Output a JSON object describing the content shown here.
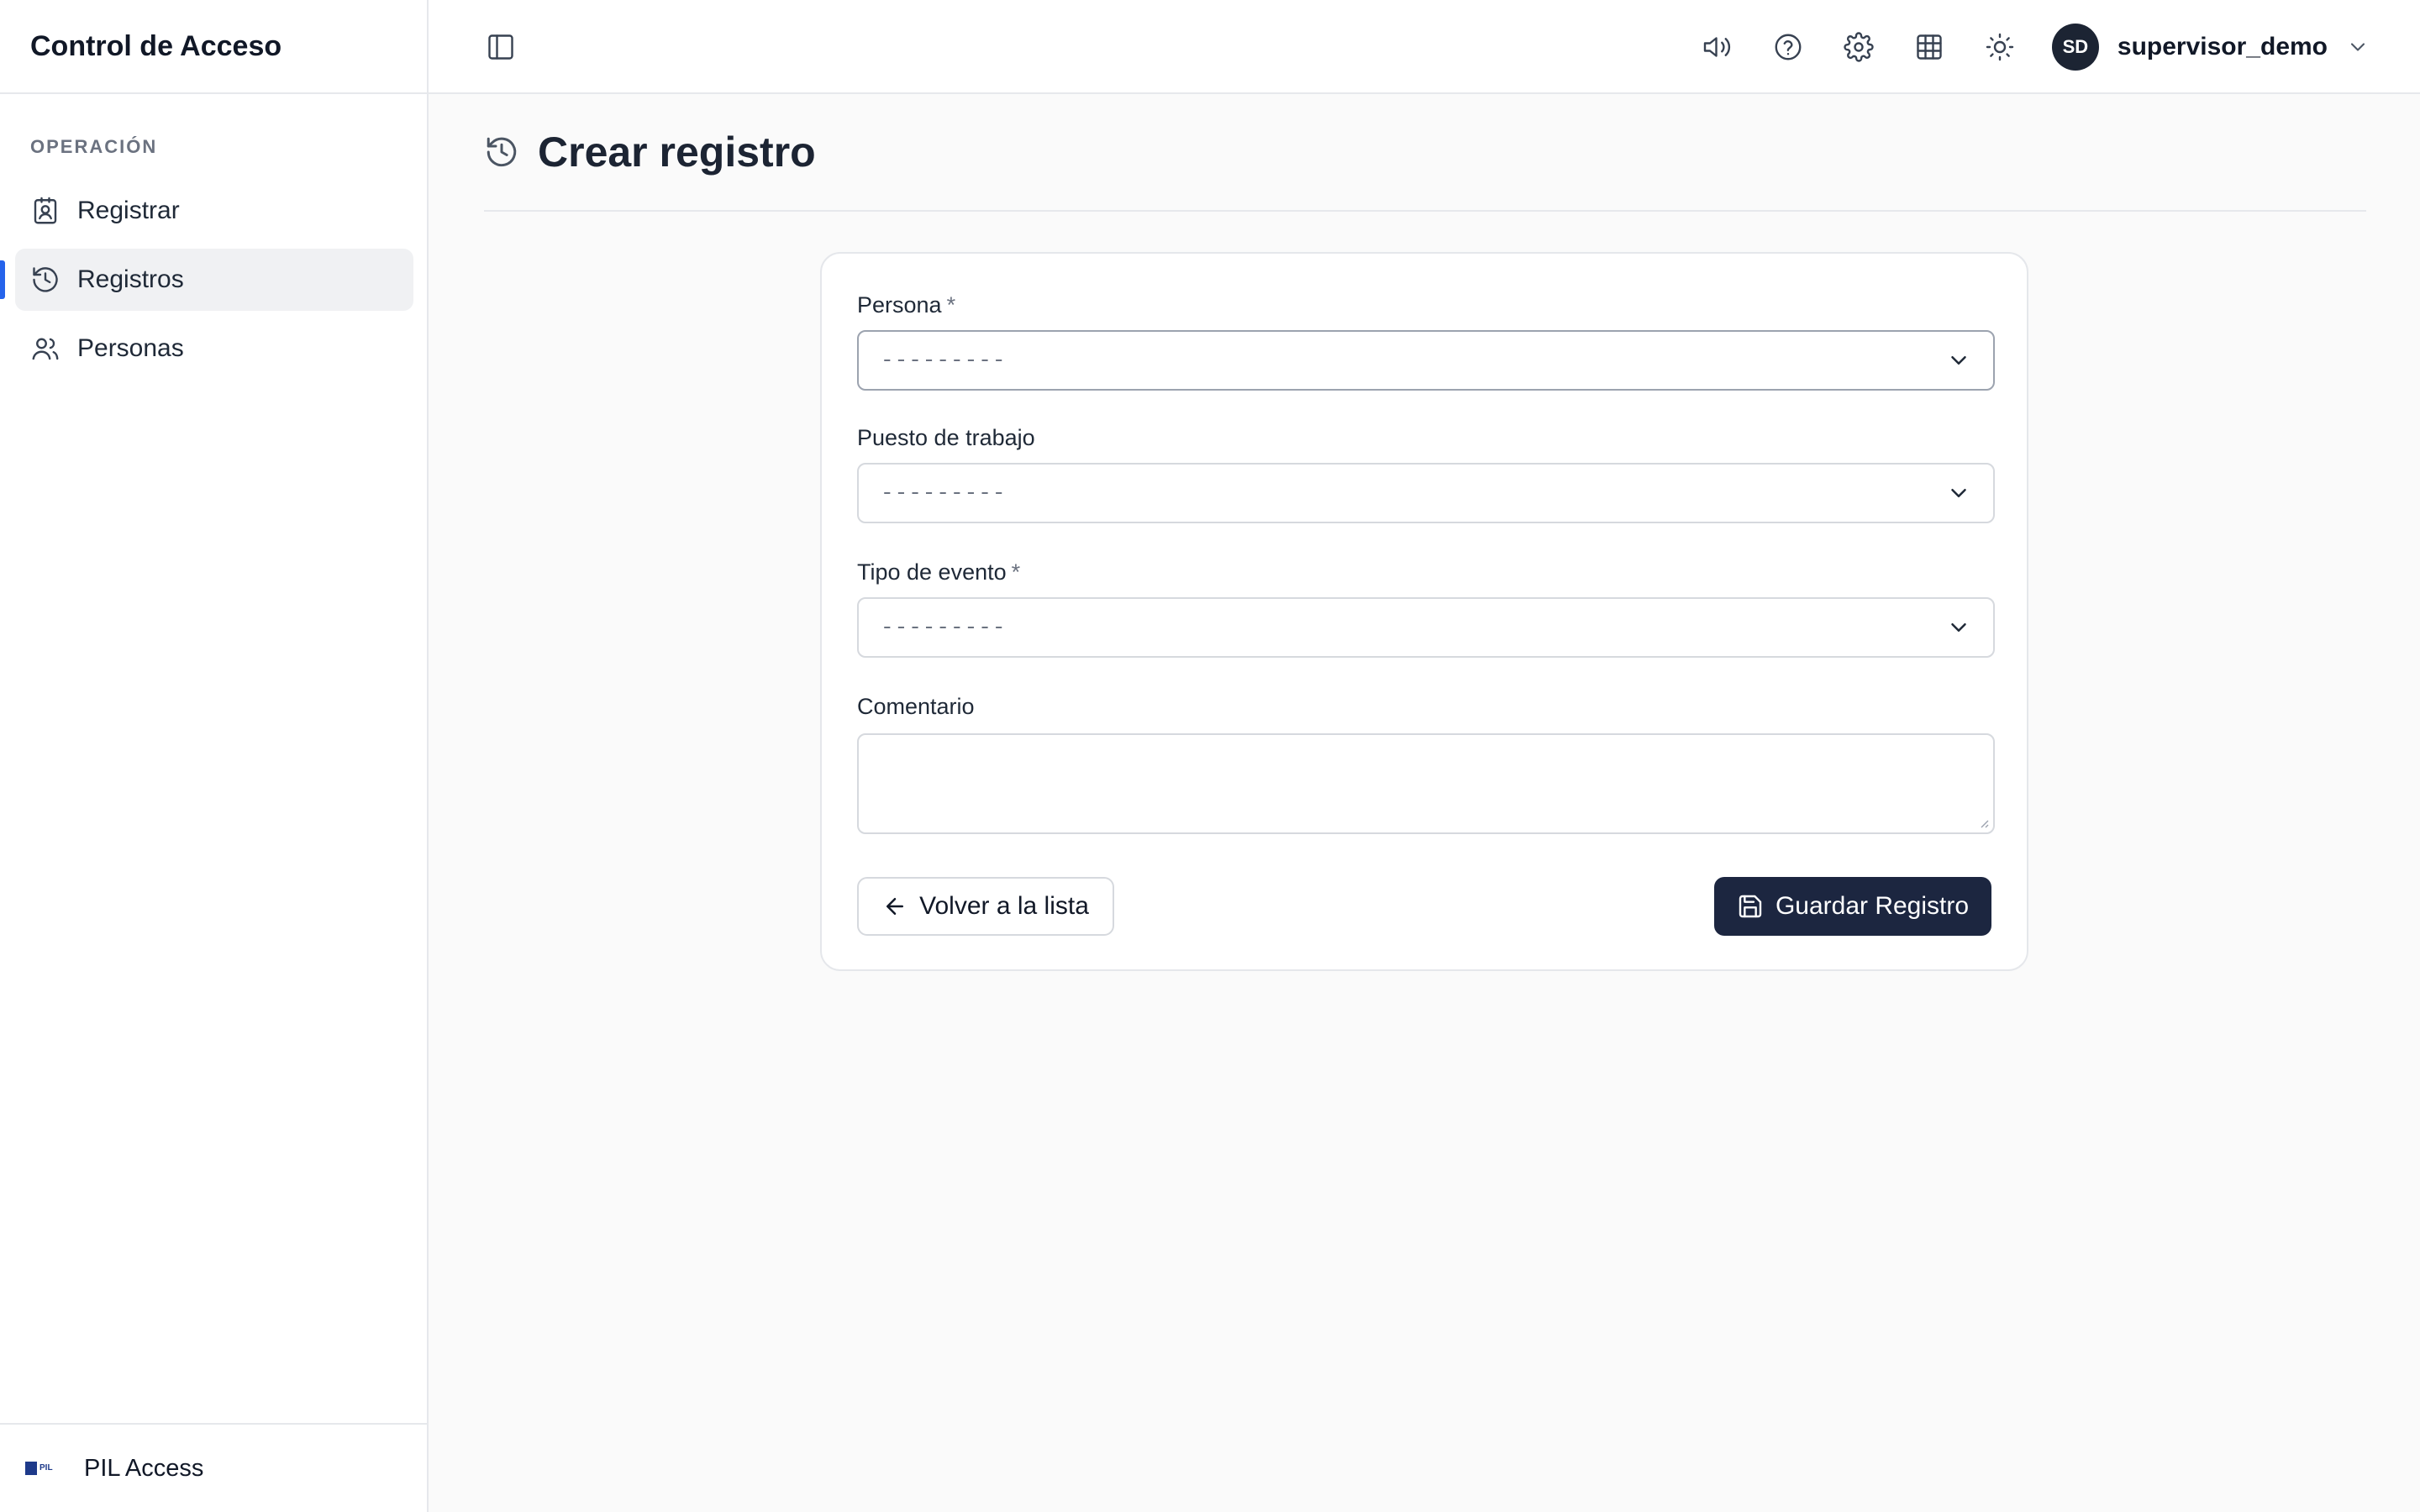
{
  "app": {
    "title": "Control de Acceso",
    "footer_name": "PIL Access",
    "logo_text": "PIL"
  },
  "sidebar": {
    "section_label": "OPERACIÓN",
    "items": [
      {
        "label": "Registrar",
        "icon": "contact-icon",
        "active": false
      },
      {
        "label": "Registros",
        "icon": "history-icon",
        "active": true
      },
      {
        "label": "Personas",
        "icon": "users-icon",
        "active": false
      }
    ]
  },
  "topbar": {
    "icons": [
      "volume-icon",
      "help-icon",
      "settings-icon",
      "grid-icon",
      "sun-icon"
    ],
    "avatar_initials": "SD",
    "username": "supervisor_demo"
  },
  "page": {
    "title": "Crear registro"
  },
  "form": {
    "persona": {
      "label": "Persona",
      "required_mark": "*",
      "value": "---------"
    },
    "puesto": {
      "label": "Puesto de trabajo",
      "value": "---------"
    },
    "tipo_evento": {
      "label": "Tipo de evento",
      "required_mark": "*",
      "value": "---------"
    },
    "comentario": {
      "label": "Comentario",
      "value": ""
    },
    "back_label": "Volver a la lista",
    "save_label": "Guardar Registro"
  },
  "colors": {
    "primary": "#1c2640",
    "active_indicator": "#2563eb",
    "background": "#fafafa"
  }
}
